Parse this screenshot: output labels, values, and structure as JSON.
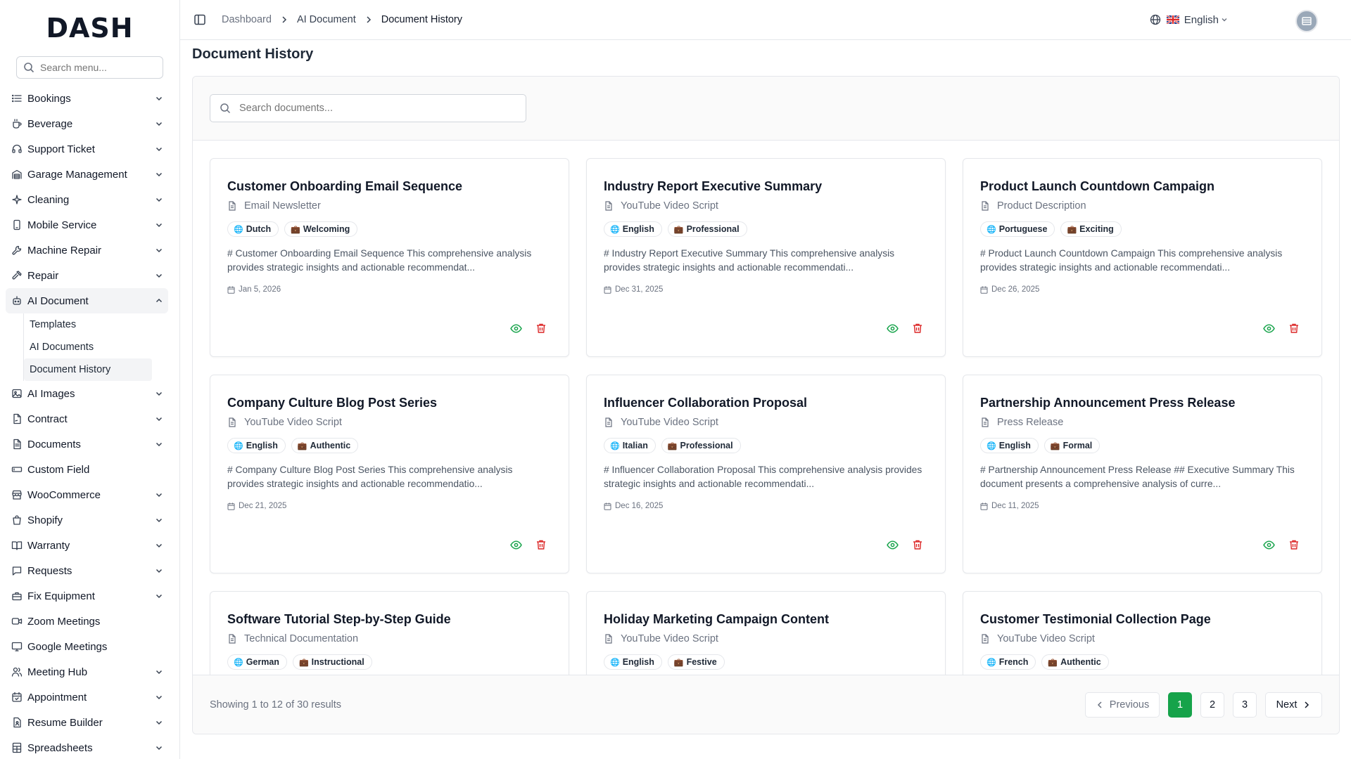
{
  "app": {
    "logo": "DASH"
  },
  "sidebar": {
    "search_placeholder": "Search menu...",
    "items": [
      {
        "label": "Bookings",
        "icon": "list-icon",
        "has_children": true
      },
      {
        "label": "Beverage",
        "icon": "cup-icon",
        "has_children": true
      },
      {
        "label": "Support Ticket",
        "icon": "headset-icon",
        "has_children": true
      },
      {
        "label": "Garage Management",
        "icon": "garage-icon",
        "has_children": true
      },
      {
        "label": "Cleaning",
        "icon": "sparkle-icon",
        "has_children": true
      },
      {
        "label": "Mobile Service",
        "icon": "phone-icon",
        "has_children": true
      },
      {
        "label": "Machine Repair",
        "icon": "wrench-icon",
        "has_children": true
      },
      {
        "label": "Repair",
        "icon": "hammer-icon",
        "has_children": true
      },
      {
        "label": "AI Document",
        "icon": "robot-icon",
        "has_children": true,
        "expanded": true,
        "children": [
          "Templates",
          "AI Documents",
          "Document History"
        ],
        "active_child": "Document History"
      },
      {
        "label": "AI Images",
        "icon": "image-icon",
        "has_children": true
      },
      {
        "label": "Contract",
        "icon": "contract-icon",
        "has_children": true
      },
      {
        "label": "Documents",
        "icon": "file-icon",
        "has_children": true
      },
      {
        "label": "Custom Field",
        "icon": "field-icon",
        "has_children": false
      },
      {
        "label": "WooCommerce",
        "icon": "store-icon",
        "has_children": true
      },
      {
        "label": "Shopify",
        "icon": "bag-icon",
        "has_children": true
      },
      {
        "label": "Warranty",
        "icon": "book-icon",
        "has_children": true
      },
      {
        "label": "Requests",
        "icon": "chat-icon",
        "has_children": true
      },
      {
        "label": "Fix Equipment",
        "icon": "toolbox-icon",
        "has_children": true
      },
      {
        "label": "Zoom Meetings",
        "icon": "video-icon",
        "has_children": false
      },
      {
        "label": "Google Meetings",
        "icon": "monitor-icon",
        "has_children": false
      },
      {
        "label": "Meeting Hub",
        "icon": "users-icon",
        "has_children": true
      },
      {
        "label": "Appointment",
        "icon": "calendar-check-icon",
        "has_children": true
      },
      {
        "label": "Resume Builder",
        "icon": "resume-icon",
        "has_children": true
      },
      {
        "label": "Spreadsheets",
        "icon": "sheet-icon",
        "has_children": true
      }
    ]
  },
  "header": {
    "breadcrumb": [
      "Dashboard",
      "AI Document",
      "Document History"
    ],
    "language": "English"
  },
  "page": {
    "title": "Document History",
    "search_placeholder": "Search documents...",
    "documents": [
      {
        "title": "Customer Onboarding Email Sequence",
        "type": "Email Newsletter",
        "language": "Dutch",
        "tone": "Welcoming",
        "preview": "# Customer Onboarding Email Sequence This comprehensive analysis provides strategic insights and actionable recommendat...",
        "date": "Jan 5, 2026"
      },
      {
        "title": "Industry Report Executive Summary",
        "type": "YouTube Video Script",
        "language": "English",
        "tone": "Professional",
        "preview": "# Industry Report Executive Summary This comprehensive analysis provides strategic insights and actionable recommendati...",
        "date": "Dec 31, 2025"
      },
      {
        "title": "Product Launch Countdown Campaign",
        "type": "Product Description",
        "language": "Portuguese",
        "tone": "Exciting",
        "preview": "# Product Launch Countdown Campaign This comprehensive analysis provides strategic insights and actionable recommendati...",
        "date": "Dec 26, 2025"
      },
      {
        "title": "Company Culture Blog Post Series",
        "type": "YouTube Video Script",
        "language": "English",
        "tone": "Authentic",
        "preview": "# Company Culture Blog Post Series This comprehensive analysis provides strategic insights and actionable recommendatio...",
        "date": "Dec 21, 2025"
      },
      {
        "title": "Influencer Collaboration Proposal",
        "type": "YouTube Video Script",
        "language": "Italian",
        "tone": "Professional",
        "preview": "# Influencer Collaboration Proposal This comprehensive analysis provides strategic insights and actionable recommendati...",
        "date": "Dec 16, 2025"
      },
      {
        "title": "Partnership Announcement Press Release",
        "type": "Press Release",
        "language": "English",
        "tone": "Formal",
        "preview": "# Partnership Announcement Press Release ## Executive Summary This document presents a comprehensive analysis of curre...",
        "date": "Dec 11, 2025"
      },
      {
        "title": "Software Tutorial Step-by-Step Guide",
        "type": "Technical Documentation",
        "language": "German",
        "tone": "Instructional",
        "preview": "",
        "date": ""
      },
      {
        "title": "Holiday Marketing Campaign Content",
        "type": "YouTube Video Script",
        "language": "English",
        "tone": "Festive",
        "preview": "",
        "date": ""
      },
      {
        "title": "Customer Testimonial Collection Page",
        "type": "YouTube Video Script",
        "language": "French",
        "tone": "Authentic",
        "preview": "",
        "date": ""
      }
    ],
    "showing_text": "Showing 1 to 12 of 30 results",
    "pagination": {
      "previous": "Previous",
      "next": "Next",
      "pages": [
        "1",
        "2",
        "3"
      ],
      "current": "1"
    }
  },
  "colors": {
    "accent": "#16a34a",
    "view_icon": "#16a34a",
    "delete_icon": "#dc2626"
  }
}
